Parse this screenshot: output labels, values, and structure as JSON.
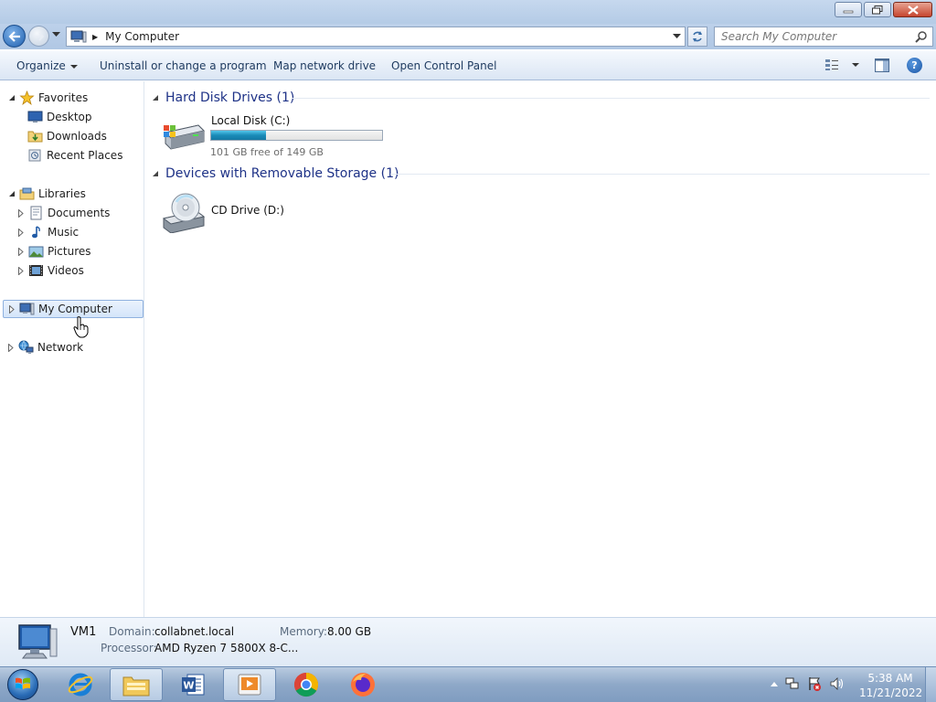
{
  "window": {
    "title_buttons": [
      "minimize-icon",
      "restore-icon",
      "close-icon"
    ]
  },
  "nav": {
    "address": "My Computer",
    "search_placeholder": "Search My Computer"
  },
  "toolbar": {
    "organize": "Organize",
    "uninstall": "Uninstall or change a program",
    "map_drive": "Map network drive",
    "control_panel": "Open Control Panel"
  },
  "sidebar": {
    "favorites": "Favorites",
    "desktop": "Desktop",
    "downloads": "Downloads",
    "recent": "Recent Places",
    "libraries": "Libraries",
    "documents": "Documents",
    "music": "Music",
    "pictures": "Pictures",
    "videos": "Videos",
    "computer": "My Computer",
    "network": "Network"
  },
  "content": {
    "hard_disk_header": "Hard Disk Drives (1)",
    "removable_header": "Devices with Removable Storage (1)",
    "local_disk": {
      "name": "Local Disk (C:)",
      "free_text": "101 GB free of 149 GB",
      "used_fraction": 0.32
    },
    "cd_drive": {
      "name": "CD Drive (D:)"
    }
  },
  "details": {
    "computer_name": "VM1",
    "domain_label": "Domain:",
    "domain_value": "collabnet.local",
    "memory_label": "Memory:",
    "memory_value": "8.00 GB",
    "processor_label": "Processor:",
    "processor_value": "AMD Ryzen 7 5800X 8-C..."
  },
  "taskbar": {
    "time": "5:38 AM",
    "date": "11/21/2022",
    "apps": [
      "internet-explorer-icon",
      "file-explorer-icon",
      "word-icon",
      "media-player-icon",
      "chrome-icon",
      "firefox-icon"
    ]
  },
  "colors": {
    "accent": "#1e3287",
    "progress": "#1a8bb8",
    "selection": "#d4e5fa"
  }
}
